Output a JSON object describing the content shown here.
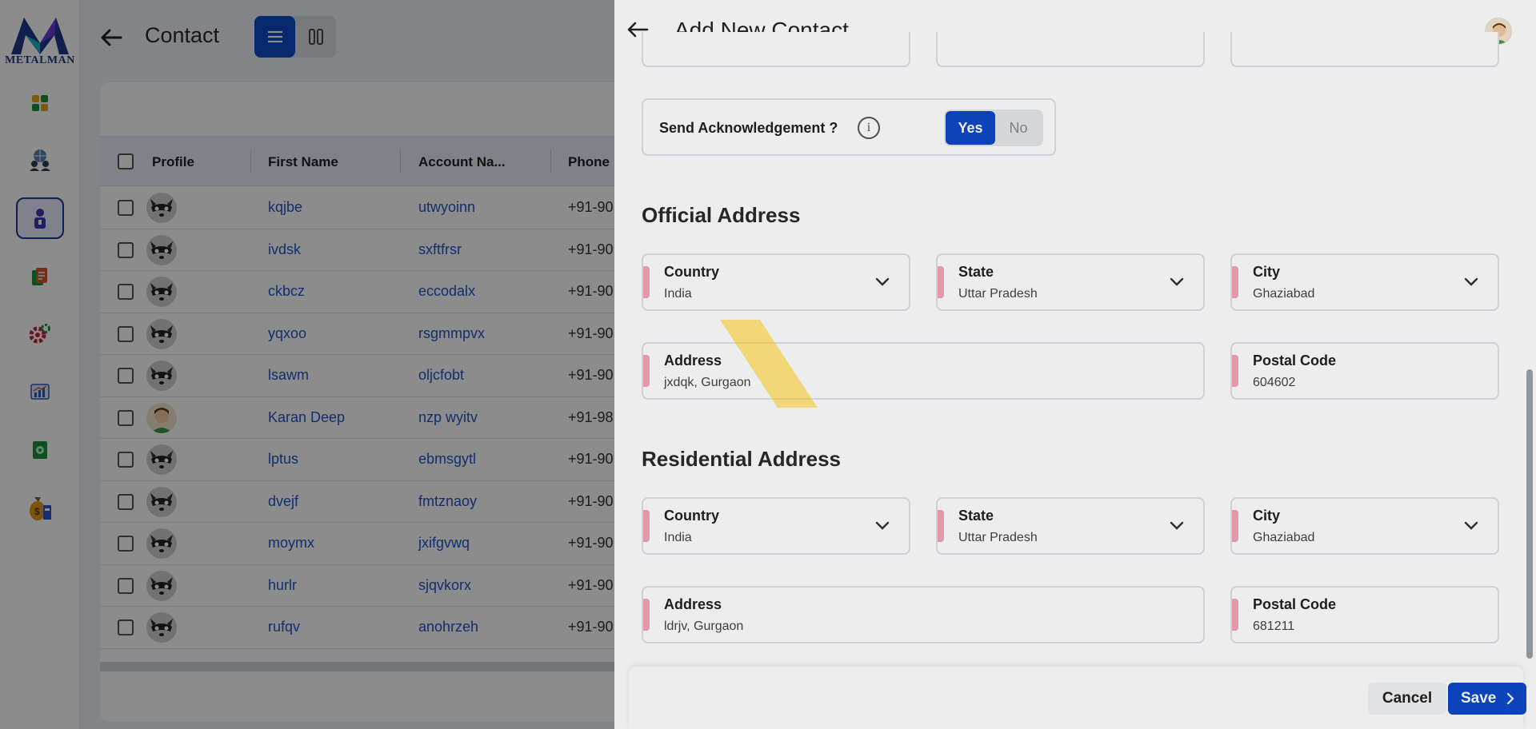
{
  "brand": {
    "name": "METALMAN"
  },
  "sidebar": {
    "items": [
      {
        "icon": "dashboard-icon",
        "color": "#e0a412"
      },
      {
        "icon": "global-users-icon",
        "color": "#2f3e5a"
      },
      {
        "icon": "contact-icon",
        "color": "#3b3bb0",
        "active": true
      },
      {
        "icon": "documents-icon",
        "color": "#d8562a"
      },
      {
        "icon": "settings-gear-icon",
        "color": "#c4203a"
      },
      {
        "icon": "reports-chart-icon",
        "color": "#2855c8"
      },
      {
        "icon": "cash-icon",
        "color": "#1b8e3a"
      },
      {
        "icon": "money-bag-icon",
        "color": "#e29a1e"
      }
    ]
  },
  "page": {
    "title": "Contact"
  },
  "table": {
    "columns": [
      "Profile",
      "First Name",
      "Account Na...",
      "Phone"
    ],
    "rows": [
      {
        "first_name": "kqjbe",
        "account": "utwyoinn",
        "phone": "+91-90",
        "avatar": "raccoon"
      },
      {
        "first_name": "ivdsk",
        "account": "sxftfrsr",
        "phone": "+91-90",
        "avatar": "raccoon"
      },
      {
        "first_name": "ckbcz",
        "account": "eccodalx",
        "phone": "+91-90",
        "avatar": "raccoon"
      },
      {
        "first_name": "yqxoo",
        "account": "rsgmmpvx",
        "phone": "+91-90",
        "avatar": "raccoon"
      },
      {
        "first_name": "lsawm",
        "account": "oljcfobt",
        "phone": "+91-90",
        "avatar": "raccoon"
      },
      {
        "first_name": "Karan Deep",
        "account": "nzp wyitv",
        "phone": "+91-98",
        "avatar": "person"
      },
      {
        "first_name": "lptus",
        "account": "ebmsgytl",
        "phone": "+91-90",
        "avatar": "raccoon"
      },
      {
        "first_name": "dvejf",
        "account": "fmtznaoy",
        "phone": "+91-90",
        "avatar": "raccoon"
      },
      {
        "first_name": "moymx",
        "account": "jxifgvwq",
        "phone": "+91-90",
        "avatar": "raccoon"
      },
      {
        "first_name": "hurlr",
        "account": "sjqvkorx",
        "phone": "+91-90",
        "avatar": "raccoon"
      },
      {
        "first_name": "rufqv",
        "account": "anohrzeh",
        "phone": "+91-90",
        "avatar": "raccoon"
      }
    ]
  },
  "drawer": {
    "title": "Add New Contact",
    "acknowledgement": {
      "label": "Send Acknowledgement ?",
      "info": "i",
      "yes": "Yes",
      "no": "No",
      "selected": "Yes"
    },
    "official_address": {
      "heading": "Official Address",
      "country": {
        "label": "Country",
        "value": "India"
      },
      "state": {
        "label": "State",
        "value": "Uttar Pradesh"
      },
      "city": {
        "label": "City",
        "value": "Ghaziabad"
      },
      "address": {
        "label": "Address",
        "value": "jxdqk, Gurgaon"
      },
      "postal": {
        "label": "Postal Code",
        "value": "604602"
      }
    },
    "residential_address": {
      "heading": "Residential Address",
      "country": {
        "label": "Country",
        "value": "India"
      },
      "state": {
        "label": "State",
        "value": "Uttar Pradesh"
      },
      "city": {
        "label": "City",
        "value": "Ghaziabad"
      },
      "address": {
        "label": "Address",
        "value": "ldrjv, Gurgaon"
      },
      "postal": {
        "label": "Postal Code",
        "value": "681211"
      }
    },
    "footer": {
      "cancel": "Cancel",
      "save": "Save"
    }
  },
  "colors": {
    "primary": "#0d47c9",
    "required_marker": "#f4a3b8",
    "link": "#1f57c8"
  }
}
